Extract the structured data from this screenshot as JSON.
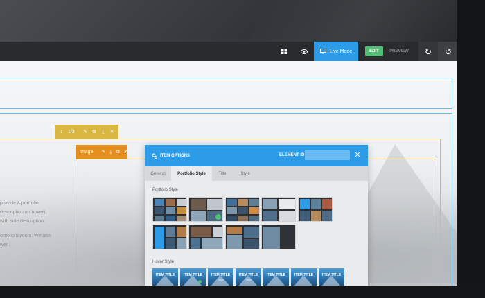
{
  "toolbar": {
    "live_mode_label": "Live Mode",
    "edit_label": "EDIT",
    "preview_label": "PREVIEW",
    "icons": [
      "grid-icon",
      "eye-icon",
      "monitor-icon",
      "undo-icon",
      "redo-icon"
    ],
    "accent_color": "#2c9be8",
    "edit_color": "#4fbf73"
  },
  "canvas": {
    "module_bar_yellow": {
      "label": "1/3",
      "color": "#d9b740"
    },
    "module_bar_orange": {
      "label": "Image",
      "color": "#e38e1f"
    },
    "body_text": [
      "provide 8 portfolio",
      "description on hover),",
      "with side description.",
      "ortfolio layouts. We also",
      "well."
    ]
  },
  "modal": {
    "title": "ITEM OPTIONS",
    "element_id_label": "ELEMENT ID :",
    "element_id_value": "",
    "tabs": [
      {
        "label": "General",
        "active": false
      },
      {
        "label": "Portfolio Style",
        "active": true
      },
      {
        "label": "Title",
        "active": false
      },
      {
        "label": "Style",
        "active": false
      }
    ],
    "portfolio_style_label": "Portfolio Style",
    "hover_style_label": "Hover Style",
    "hover_items": [
      {
        "title": "ITEM TITLE",
        "sub": ""
      },
      {
        "title": "ITEM TITLE",
        "sub": ""
      },
      {
        "title": "ITEM TITLE",
        "sub": "Tags"
      },
      {
        "title": "ITEM TITLE",
        "sub": "Tags"
      },
      {
        "title": "ITEM TITLE",
        "sub": ""
      },
      {
        "title": "ITEM TITLE",
        "sub": ""
      },
      {
        "title": "ITEM TITLE",
        "sub": ""
      }
    ]
  }
}
